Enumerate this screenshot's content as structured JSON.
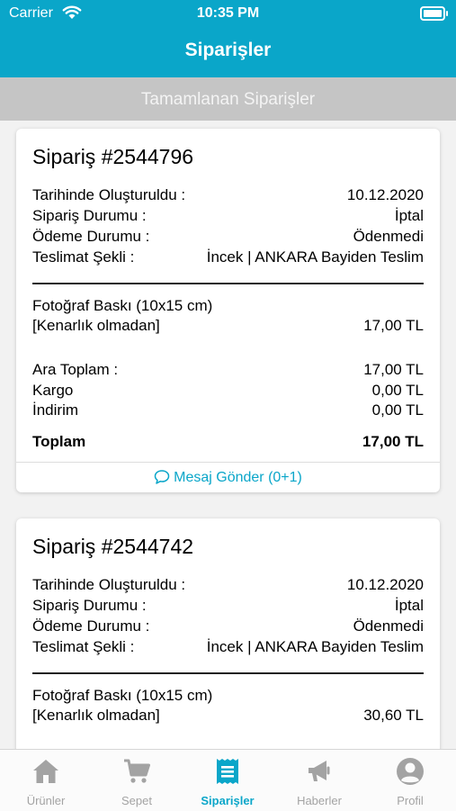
{
  "status": {
    "carrier": "Carrier",
    "time": "10:35 PM"
  },
  "nav": {
    "title": "Siparişler"
  },
  "subbar": {
    "label": "Tamamlanan Siparişler"
  },
  "orders": [
    {
      "title": "Sipariş #2544796",
      "created_label": "Tarihinde Oluşturuldu :",
      "created_value": "10.12.2020",
      "status_label": "Sipariş Durumu :",
      "status_value": "İptal",
      "payment_label": "Ödeme Durumu :",
      "payment_value": "Ödenmedi",
      "delivery_label": "Teslimat Şekli :",
      "delivery_value": "İncek | ANKARA  Bayiden Teslim",
      "item_name": "Fotoğraf Baskı (10x15 cm)",
      "item_option": "[Kenarlık olmadan]",
      "item_price": "17,00 TL",
      "subtotal_label": "Ara Toplam :",
      "subtotal_value": "17,00 TL",
      "shipping_label": "Kargo",
      "shipping_value": "0,00 TL",
      "discount_label": "İndirim",
      "discount_value": "0,00 TL",
      "total_label": "Toplam",
      "total_value": "17,00 TL",
      "message_label": "Mesaj Gönder (0+1)"
    },
    {
      "title": "Sipariş #2544742",
      "created_label": "Tarihinde Oluşturuldu :",
      "created_value": "10.12.2020",
      "status_label": "Sipariş Durumu :",
      "status_value": "İptal",
      "payment_label": "Ödeme Durumu :",
      "payment_value": "Ödenmedi",
      "delivery_label": "Teslimat Şekli :",
      "delivery_value": "İncek | ANKARA  Bayiden Teslim",
      "item_name": "Fotoğraf Baskı (10x15 cm)",
      "item_option": "[Kenarlık olmadan]",
      "item_price": "30,60 TL"
    }
  ],
  "tabs": [
    {
      "label": "Ürünler",
      "icon": "home-icon"
    },
    {
      "label": "Sepet",
      "icon": "cart-icon"
    },
    {
      "label": "Siparişler",
      "icon": "orders-icon"
    },
    {
      "label": "Haberler",
      "icon": "megaphone-icon"
    },
    {
      "label": "Profil",
      "icon": "profile-icon"
    }
  ],
  "colors": {
    "accent": "#0aa6c9",
    "subbar": "#c5c5c5",
    "inactive": "#a3a3a3"
  }
}
